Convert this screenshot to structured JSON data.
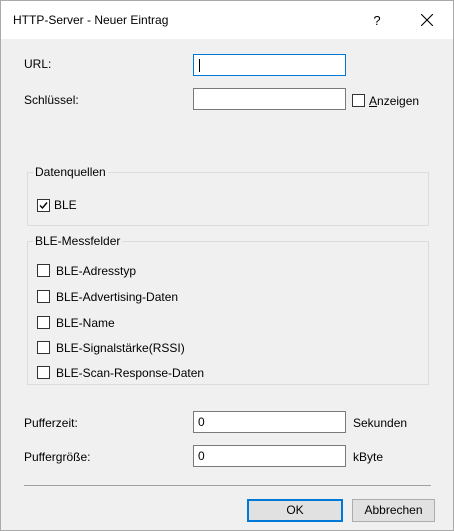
{
  "window": {
    "title": "HTTP-Server - Neuer Eintrag",
    "help_label": "?"
  },
  "form": {
    "url_label": "URL:",
    "url_value": "",
    "key_label": "Schlüssel:",
    "key_value": "",
    "show_label_accel": "A",
    "show_label_rest": "nzeigen",
    "show_checked": false
  },
  "datasources": {
    "title": "Datenquellen",
    "items": [
      {
        "label": "BLE",
        "checked": true
      }
    ]
  },
  "ble_fields": {
    "title": "BLE-Messfelder",
    "items": [
      {
        "label": "BLE-Adresstyp",
        "checked": false
      },
      {
        "label": "BLE-Advertising-Daten",
        "checked": false
      },
      {
        "label": "BLE-Name",
        "checked": false
      },
      {
        "label": "BLE-Signalstärke(RSSI)",
        "checked": false
      },
      {
        "label": "BLE-Scan-Response-Daten",
        "checked": false
      }
    ]
  },
  "buffer": {
    "time_label": "Pufferzeit:",
    "time_value": "0",
    "time_unit": "Sekunden",
    "size_label": "Puffergröße:",
    "size_value": "0",
    "size_unit": "kByte"
  },
  "buttons": {
    "ok_label": "OK",
    "cancel_label": "Abbrechen"
  }
}
